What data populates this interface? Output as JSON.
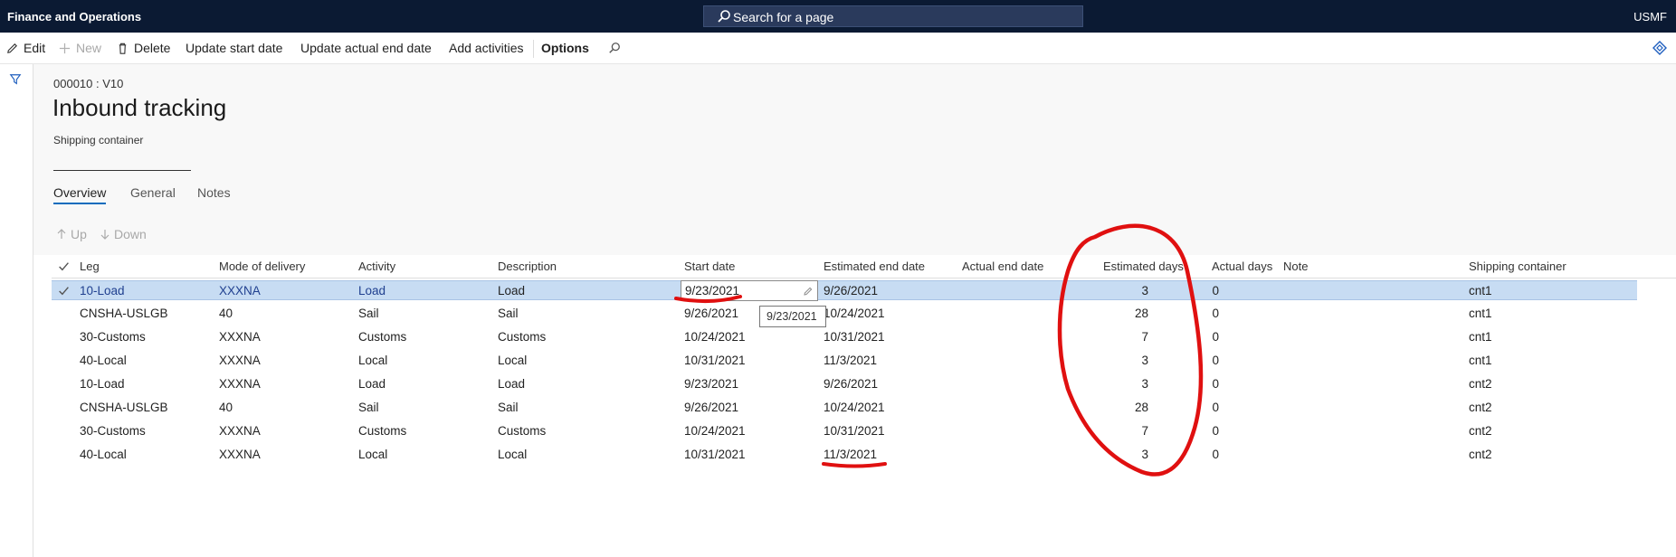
{
  "topbar": {
    "app_title": "Finance and Operations",
    "search_placeholder": "Search for a page",
    "company": "USMF"
  },
  "actionpane": {
    "edit": "Edit",
    "new": "New",
    "delete": "Delete",
    "update_start_date": "Update start date",
    "update_actual_end_date": "Update actual end date",
    "add_activities": "Add activities",
    "options": "Options"
  },
  "header": {
    "record_id": "000010 : V10",
    "title": "Inbound tracking",
    "subtitle": "Shipping container"
  },
  "tabs": [
    "Overview",
    "General",
    "Notes"
  ],
  "grid_buttons": {
    "up": "Up",
    "down": "Down"
  },
  "grid": {
    "columns": [
      "Leg",
      "Mode of delivery",
      "Activity",
      "Description",
      "Start date",
      "Estimated end date",
      "Actual end date",
      "Estimated days",
      "Actual days",
      "Note",
      "Shipping container"
    ],
    "rows": [
      {
        "leg": "10-Load",
        "mode": "XXXNA",
        "activity": "Load",
        "description": "Load",
        "start": "9/23/2021",
        "est_end": "9/26/2021",
        "actual_end": "",
        "est_days": "3",
        "actual_days": "0",
        "note": "",
        "container": "cnt1"
      },
      {
        "leg": "CNSHA-USLGB",
        "mode": "40",
        "activity": "Sail",
        "description": "Sail",
        "start": "9/26/2021",
        "est_end": "10/24/2021",
        "actual_end": "",
        "est_days": "28",
        "actual_days": "0",
        "note": "",
        "container": "cnt1"
      },
      {
        "leg": "30-Customs",
        "mode": "XXXNA",
        "activity": "Customs",
        "description": "Customs",
        "start": "10/24/2021",
        "est_end": "10/31/2021",
        "actual_end": "",
        "est_days": "7",
        "actual_days": "0",
        "note": "",
        "container": "cnt1"
      },
      {
        "leg": "40-Local",
        "mode": "XXXNA",
        "activity": "Local",
        "description": "Local",
        "start": "10/31/2021",
        "est_end": "11/3/2021",
        "actual_end": "",
        "est_days": "3",
        "actual_days": "0",
        "note": "",
        "container": "cnt1"
      },
      {
        "leg": "10-Load",
        "mode": "XXXNA",
        "activity": "Load",
        "description": "Load",
        "start": "9/23/2021",
        "est_end": "9/26/2021",
        "actual_end": "",
        "est_days": "3",
        "actual_days": "0",
        "note": "",
        "container": "cnt2"
      },
      {
        "leg": "CNSHA-USLGB",
        "mode": "40",
        "activity": "Sail",
        "description": "Sail",
        "start": "9/26/2021",
        "est_end": "10/24/2021",
        "actual_end": "",
        "est_days": "28",
        "actual_days": "0",
        "note": "",
        "container": "cnt2"
      },
      {
        "leg": "30-Customs",
        "mode": "XXXNA",
        "activity": "Customs",
        "description": "Customs",
        "start": "10/24/2021",
        "est_end": "10/31/2021",
        "actual_end": "",
        "est_days": "7",
        "actual_days": "0",
        "note": "",
        "container": "cnt2"
      },
      {
        "leg": "40-Local",
        "mode": "XXXNA",
        "activity": "Local",
        "description": "Local",
        "start": "10/31/2021",
        "est_end": "11/3/2021",
        "actual_end": "",
        "est_days": "3",
        "actual_days": "0",
        "note": "",
        "container": "cnt2"
      }
    ]
  },
  "editor": {
    "value": "9/23/2021",
    "tooltip": "9/23/2021"
  },
  "colors": {
    "topbar": "#0b1a33",
    "selected_row": "#c7dcf3",
    "annotation": "#e01010"
  }
}
